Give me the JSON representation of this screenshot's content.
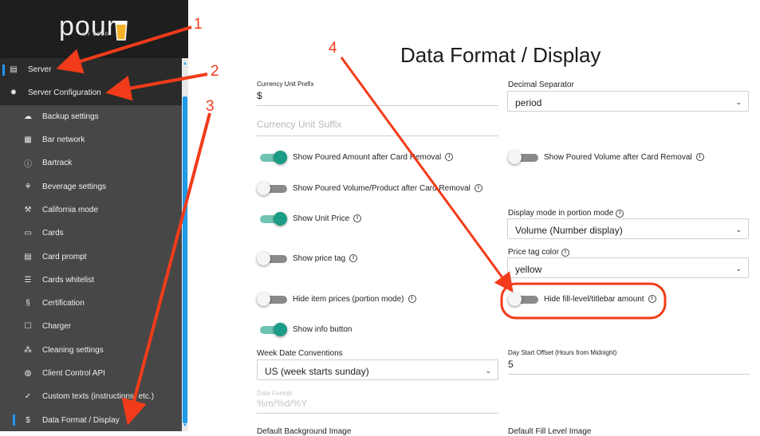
{
  "brand": {
    "logo": "pour",
    "sub": "MY BEER"
  },
  "sidebar": {
    "items": [
      {
        "label": "Server",
        "icon": "server-icon",
        "glyph": "▤"
      },
      {
        "label": "Server Configuration",
        "icon": "gear-icon",
        "glyph": "✹"
      },
      {
        "label": "Backup settings",
        "icon": "cloud-upload-icon",
        "glyph": "☁"
      },
      {
        "label": "Bar network",
        "icon": "network-icon",
        "glyph": "▦"
      },
      {
        "label": "Bartrack",
        "icon": "info-circle-icon",
        "glyph": "ⓘ"
      },
      {
        "label": "Beverage settings",
        "icon": "beverage-icon",
        "glyph": "⚘"
      },
      {
        "label": "California mode",
        "icon": "gavel-icon",
        "glyph": "⚒"
      },
      {
        "label": "Cards",
        "icon": "card-icon",
        "glyph": "▭"
      },
      {
        "label": "Card prompt",
        "icon": "message-icon",
        "glyph": "▤"
      },
      {
        "label": "Cards whitelist",
        "icon": "list-icon",
        "glyph": "☰"
      },
      {
        "label": "Certification",
        "icon": "section-icon",
        "glyph": "§"
      },
      {
        "label": "Charger",
        "icon": "square-icon",
        "glyph": "☐"
      },
      {
        "label": "Cleaning settings",
        "icon": "sparkle-icon",
        "glyph": "⁂"
      },
      {
        "label": "Client Control API",
        "icon": "api-icon",
        "glyph": "◍"
      },
      {
        "label": "Custom texts (instructions, etc.)",
        "icon": "check-icon",
        "glyph": "✓"
      },
      {
        "label": "Data Format / Display",
        "icon": "dollar-icon",
        "glyph": "$"
      }
    ]
  },
  "page": {
    "title": "Data Format / Display"
  },
  "form": {
    "currency_prefix": {
      "label": "Currency Unit Prefix",
      "value": "$"
    },
    "currency_suffix": {
      "placeholder": "Currency Unit Suffix"
    },
    "decimal_separator": {
      "label": "Decimal Separator",
      "value": "period"
    },
    "toggles": {
      "poured_amount": {
        "label": "Show Poured Amount after Card Removal",
        "on": true
      },
      "poured_volume": {
        "label": "Show Poured Volume after Card Removal",
        "on": false
      },
      "poured_volume_product": {
        "label": "Show Poured Volume/Product after Card Removal",
        "on": false
      },
      "unit_price": {
        "label": "Show Unit Price",
        "on": true
      },
      "price_tag": {
        "label": "Show price tag",
        "on": false
      },
      "hide_item_prices": {
        "label": "Hide item prices (portion mode)",
        "on": false
      },
      "hide_fill_level": {
        "label": "Hide fill-level/titlebar amount",
        "on": false
      },
      "info_button": {
        "label": "Show info button",
        "on": true
      }
    },
    "display_mode": {
      "label": "Display mode in portion mode",
      "value": "Volume (Number display)"
    },
    "price_tag_color": {
      "label": "Price tag color",
      "value": "yellow"
    },
    "week_date": {
      "label": "Week Date Conventions",
      "value": "US (week starts sunday)"
    },
    "day_start_offset": {
      "label": "Day Start Offset (Hours from Midnight)",
      "value": "5"
    },
    "date_format": {
      "label": "Date Format",
      "value": "%m/%d/%Y"
    },
    "default_bg_image": {
      "label": "Default Background Image"
    },
    "default_fill_image": {
      "label": "Default Fill Level Image"
    }
  },
  "annotations": [
    "1",
    "2",
    "3",
    "4"
  ],
  "colors": {
    "accent": "#2196f3",
    "toggle_on": "#1a9c86",
    "annotation": "#f23b1a"
  }
}
